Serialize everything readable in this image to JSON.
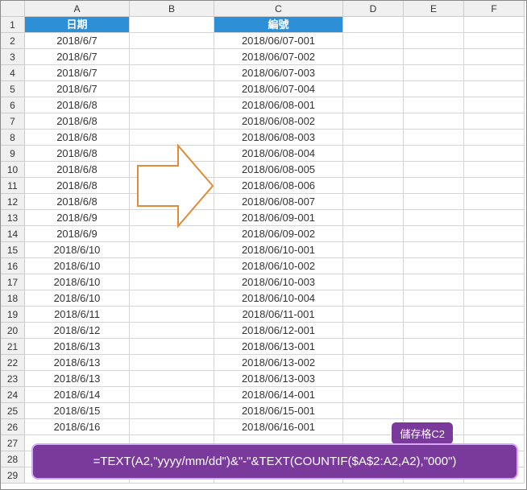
{
  "columns": [
    "",
    "A",
    "B",
    "C",
    "D",
    "E",
    "F"
  ],
  "header": {
    "A": "日期",
    "C": "編號"
  },
  "rows": [
    {
      "n": 1,
      "A": "日期",
      "C": "編號",
      "isHeader": true
    },
    {
      "n": 2,
      "A": "2018/6/7",
      "C": "2018/06/07-001"
    },
    {
      "n": 3,
      "A": "2018/6/7",
      "C": "2018/06/07-002"
    },
    {
      "n": 4,
      "A": "2018/6/7",
      "C": "2018/06/07-003"
    },
    {
      "n": 5,
      "A": "2018/6/7",
      "C": "2018/06/07-004"
    },
    {
      "n": 6,
      "A": "2018/6/8",
      "C": "2018/06/08-001"
    },
    {
      "n": 7,
      "A": "2018/6/8",
      "C": "2018/06/08-002"
    },
    {
      "n": 8,
      "A": "2018/6/8",
      "C": "2018/06/08-003"
    },
    {
      "n": 9,
      "A": "2018/6/8",
      "C": "2018/06/08-004"
    },
    {
      "n": 10,
      "A": "2018/6/8",
      "C": "2018/06/08-005"
    },
    {
      "n": 11,
      "A": "2018/6/8",
      "C": "2018/06/08-006"
    },
    {
      "n": 12,
      "A": "2018/6/8",
      "C": "2018/06/08-007"
    },
    {
      "n": 13,
      "A": "2018/6/9",
      "C": "2018/06/09-001"
    },
    {
      "n": 14,
      "A": "2018/6/9",
      "C": "2018/06/09-002"
    },
    {
      "n": 15,
      "A": "2018/6/10",
      "C": "2018/06/10-001"
    },
    {
      "n": 16,
      "A": "2018/6/10",
      "C": "2018/06/10-002"
    },
    {
      "n": 17,
      "A": "2018/6/10",
      "C": "2018/06/10-003"
    },
    {
      "n": 18,
      "A": "2018/6/10",
      "C": "2018/06/10-004"
    },
    {
      "n": 19,
      "A": "2018/6/11",
      "C": "2018/06/11-001"
    },
    {
      "n": 20,
      "A": "2018/6/12",
      "C": "2018/06/12-001"
    },
    {
      "n": 21,
      "A": "2018/6/13",
      "C": "2018/06/13-001"
    },
    {
      "n": 22,
      "A": "2018/6/13",
      "C": "2018/06/13-002"
    },
    {
      "n": 23,
      "A": "2018/6/13",
      "C": "2018/06/13-003"
    },
    {
      "n": 24,
      "A": "2018/6/14",
      "C": "2018/06/14-001"
    },
    {
      "n": 25,
      "A": "2018/6/15",
      "C": "2018/06/15-001"
    },
    {
      "n": 26,
      "A": "2018/6/16",
      "C": "2018/06/16-001"
    },
    {
      "n": 27,
      "A": "",
      "C": ""
    },
    {
      "n": 28,
      "A": "",
      "C": ""
    },
    {
      "n": 29,
      "A": "",
      "C": ""
    }
  ],
  "callout": {
    "badge": "儲存格C2",
    "formula": "=TEXT(A2,\"yyyy/mm/dd\")&\"-\"&TEXT(COUNTIF($A$2:A2,A2),\"000\")"
  }
}
